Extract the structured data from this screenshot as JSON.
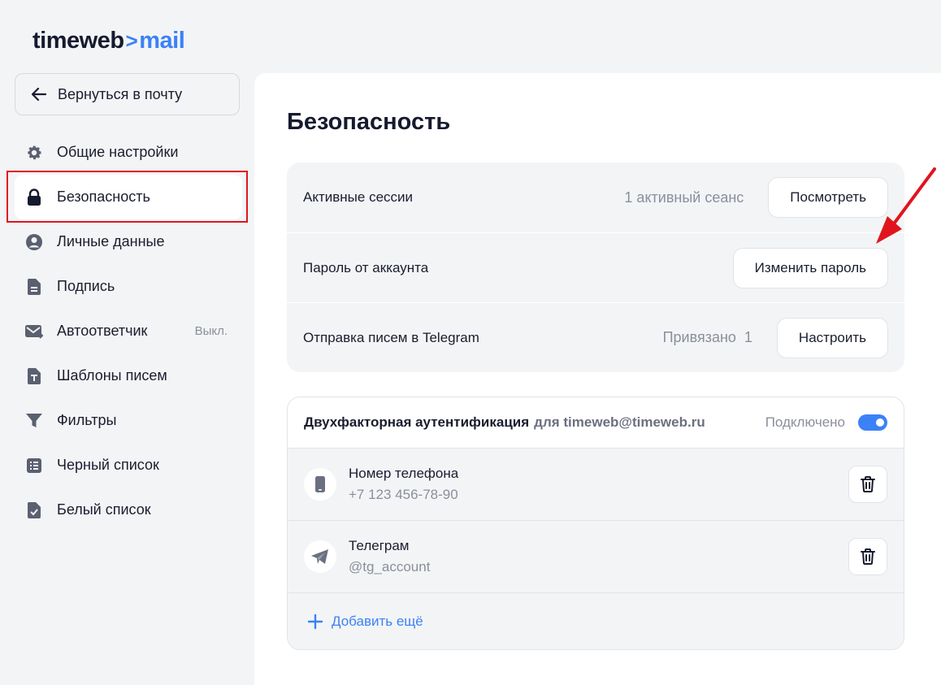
{
  "logo": {
    "brand": "timeweb",
    "separator": ">",
    "product": "mail"
  },
  "back_button": {
    "label": "Вернуться в почту",
    "icon": "arrow-left-icon"
  },
  "sidebar": {
    "items": [
      {
        "label": "Общие настройки",
        "icon": "gear-icon"
      },
      {
        "label": "Безопасность",
        "icon": "lock-icon",
        "active": true
      },
      {
        "label": "Личные данные",
        "icon": "user-circle-icon"
      },
      {
        "label": "Подпись",
        "icon": "document-icon"
      },
      {
        "label": "Автоответчик",
        "icon": "mail-forward-icon",
        "badge": "Выкл."
      },
      {
        "label": "Шаблоны писем",
        "icon": "template-icon"
      },
      {
        "label": "Фильтры",
        "icon": "filter-icon"
      },
      {
        "label": "Черный список",
        "icon": "list-icon"
      },
      {
        "label": "Белый список",
        "icon": "check-document-icon"
      }
    ]
  },
  "main": {
    "title": "Безопасность",
    "settings": [
      {
        "label": "Активные сессии",
        "meta": "1 активный сеанс",
        "button": "Посмотреть"
      },
      {
        "label": "Пароль от аккаунта",
        "meta": "",
        "button": "Изменить пароль"
      },
      {
        "label": "Отправка писем в Telegram",
        "meta": "Привязано  1",
        "button": "Настроить"
      }
    ],
    "two_factor": {
      "title": "Двухфакторная аутентификация",
      "for_account": "для timeweb@timeweb.ru",
      "status": "Подключено",
      "enabled": true,
      "methods": [
        {
          "title": "Номер телефона",
          "value": "+7 123 456-78-90",
          "icon": "phone-icon"
        },
        {
          "title": "Телеграм",
          "value": "@tg_account",
          "icon": "telegram-icon"
        }
      ],
      "add_more": "Добавить ещё"
    }
  },
  "colors": {
    "accent": "#3b82f6",
    "highlight": "#e1141d",
    "text": "#1a1d2e",
    "muted": "#8a8f9c"
  }
}
